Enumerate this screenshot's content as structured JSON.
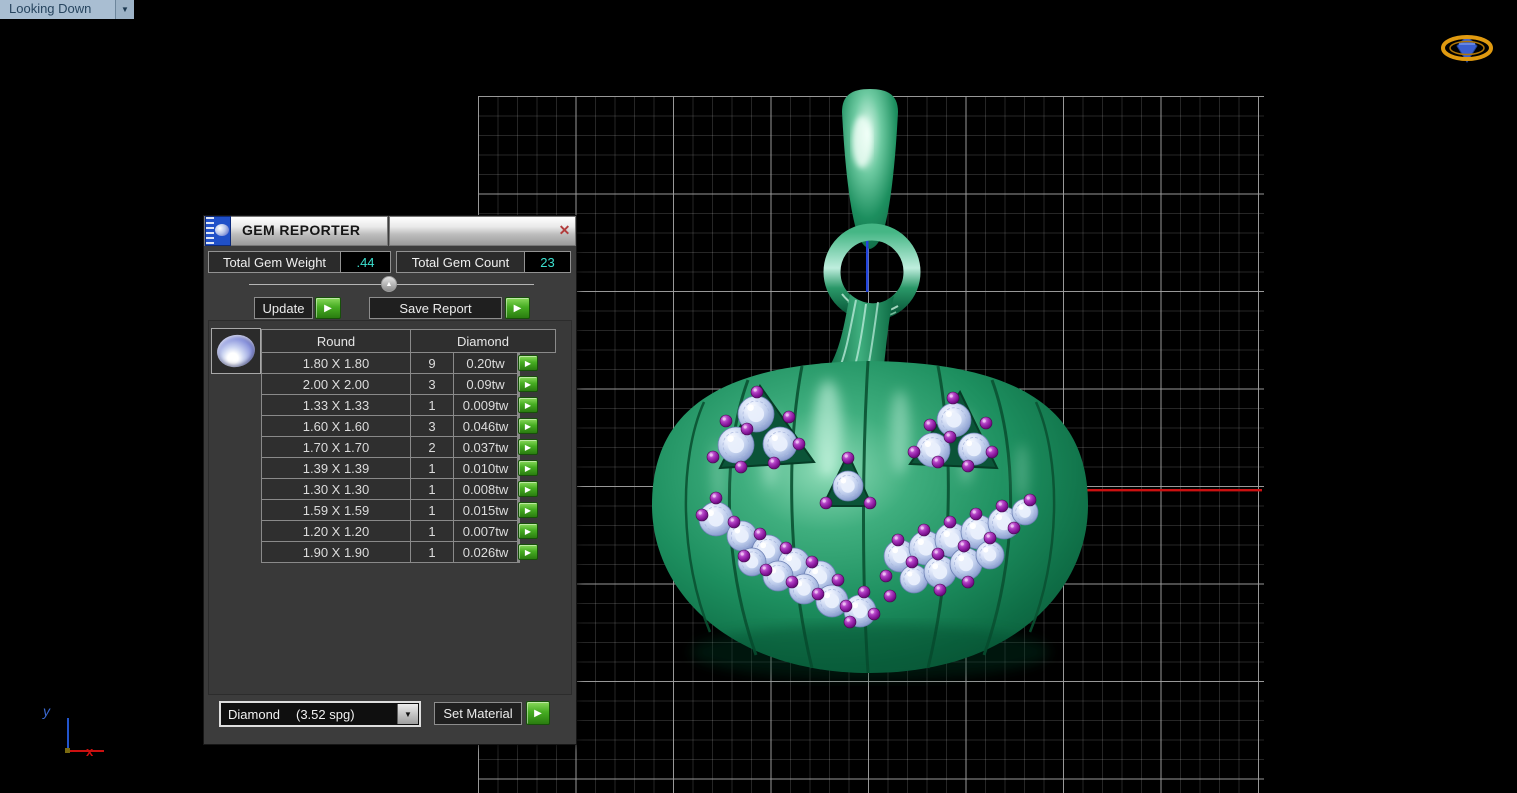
{
  "viewport": {
    "view_label": "Looking Down",
    "dropdown_icon": "▼"
  },
  "axis_gizmo": {
    "x_label": "x",
    "y_label": "y"
  },
  "gem_reporter": {
    "title": "GEM REPORTER",
    "close_icon": "✕",
    "collapse_icon": "▲",
    "stats": {
      "weight_label": "Total Gem Weight",
      "weight_value": ".44",
      "count_label": "Total Gem Count",
      "count_value": "23"
    },
    "actions": {
      "update_label": "Update",
      "save_report_label": "Save Report",
      "set_material_label": "Set Material",
      "run_icon": "▶"
    },
    "table": {
      "shape_header": "Round",
      "material_header": "Diamond",
      "rows": [
        {
          "size": "1.80 X 1.80",
          "count": "9",
          "weight": "0.20tw"
        },
        {
          "size": "2.00 X 2.00",
          "count": "3",
          "weight": "0.09tw"
        },
        {
          "size": "1.33 X 1.33",
          "count": "1",
          "weight": "0.009tw"
        },
        {
          "size": "1.60 X 1.60",
          "count": "3",
          "weight": "0.046tw"
        },
        {
          "size": "1.70 X 1.70",
          "count": "2",
          "weight": "0.037tw"
        },
        {
          "size": "1.39 X 1.39",
          "count": "1",
          "weight": "0.010tw"
        },
        {
          "size": "1.30 X 1.30",
          "count": "1",
          "weight": "0.008tw"
        },
        {
          "size": "1.59 X 1.59",
          "count": "1",
          "weight": "0.015tw"
        },
        {
          "size": "1.20 X 1.20",
          "count": "1",
          "weight": "0.007tw"
        },
        {
          "size": "1.90 X 1.90",
          "count": "1",
          "weight": "0.026tw"
        }
      ]
    },
    "material_combo": {
      "material": "Diamond",
      "density": "(3.52 spg)",
      "dropdown_icon": "▼"
    }
  },
  "colors": {
    "value-cyan": "#3ce0cf",
    "button-green": "#3f9e1d",
    "pumpkin-green": "#1d8f5f",
    "gem-blue": "#c2d0ee",
    "bead-purple": "#8a1b9c",
    "axis-red": "#cc1010",
    "axis-blue": "#2255cc",
    "halo-gold": "#d4900a"
  }
}
